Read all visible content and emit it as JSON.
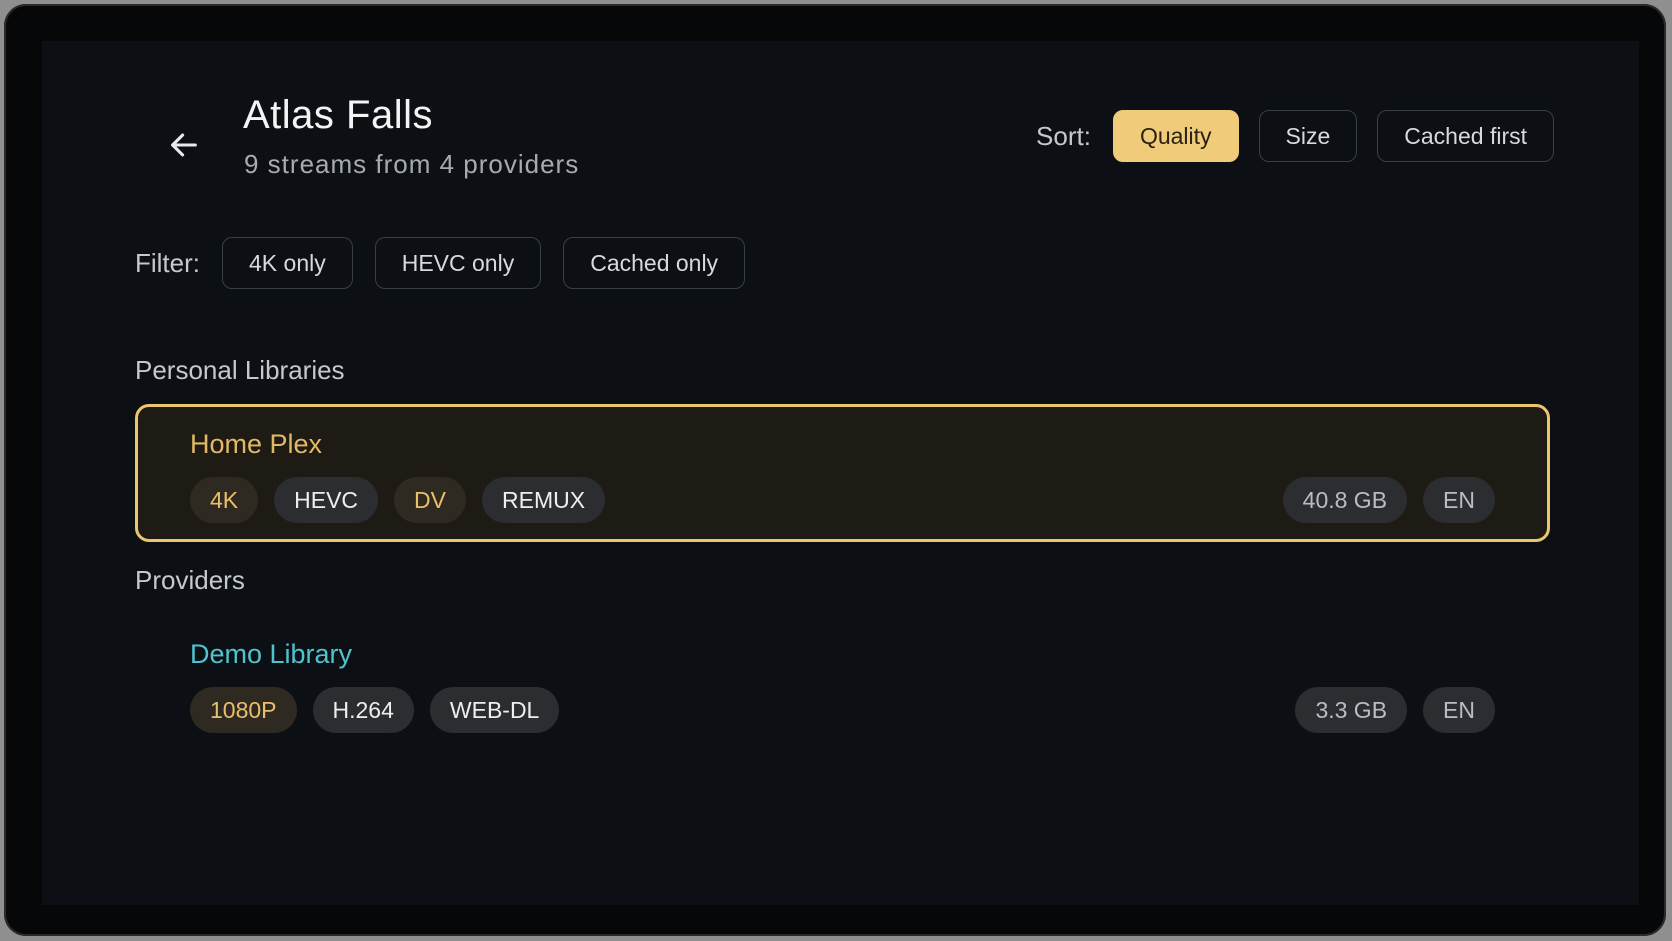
{
  "header": {
    "title": "Atlas Falls",
    "subtitle": "9 streams from 4 providers"
  },
  "sort": {
    "label": "Sort:",
    "options": [
      "Quality",
      "Size",
      "Cached first"
    ],
    "selected": "Quality"
  },
  "filter": {
    "label": "Filter:",
    "options": [
      "4K only",
      "HEVC only",
      "Cached only"
    ]
  },
  "sections": [
    {
      "heading": "Personal Libraries",
      "streams": [
        {
          "name": "Home Plex",
          "name_color": "#e2b867",
          "selected": true,
          "tags": [
            "4K",
            "HEVC",
            "DV",
            "REMUX"
          ],
          "size": "40.8 GB",
          "language": "EN"
        }
      ]
    },
    {
      "heading": "Providers",
      "streams": [
        {
          "name": "Demo Library",
          "name_color": "#4fc3cf",
          "selected": false,
          "tags": [
            "1080P",
            "H.264",
            "WEB-DL"
          ],
          "size": "3.3 GB",
          "language": "EN"
        }
      ]
    }
  ],
  "colors": {
    "accent": "#f0cb7a",
    "background": "#0c1015",
    "selected_card_border": "#ecc56f"
  },
  "icons": {
    "back": "arrow-left-icon"
  }
}
